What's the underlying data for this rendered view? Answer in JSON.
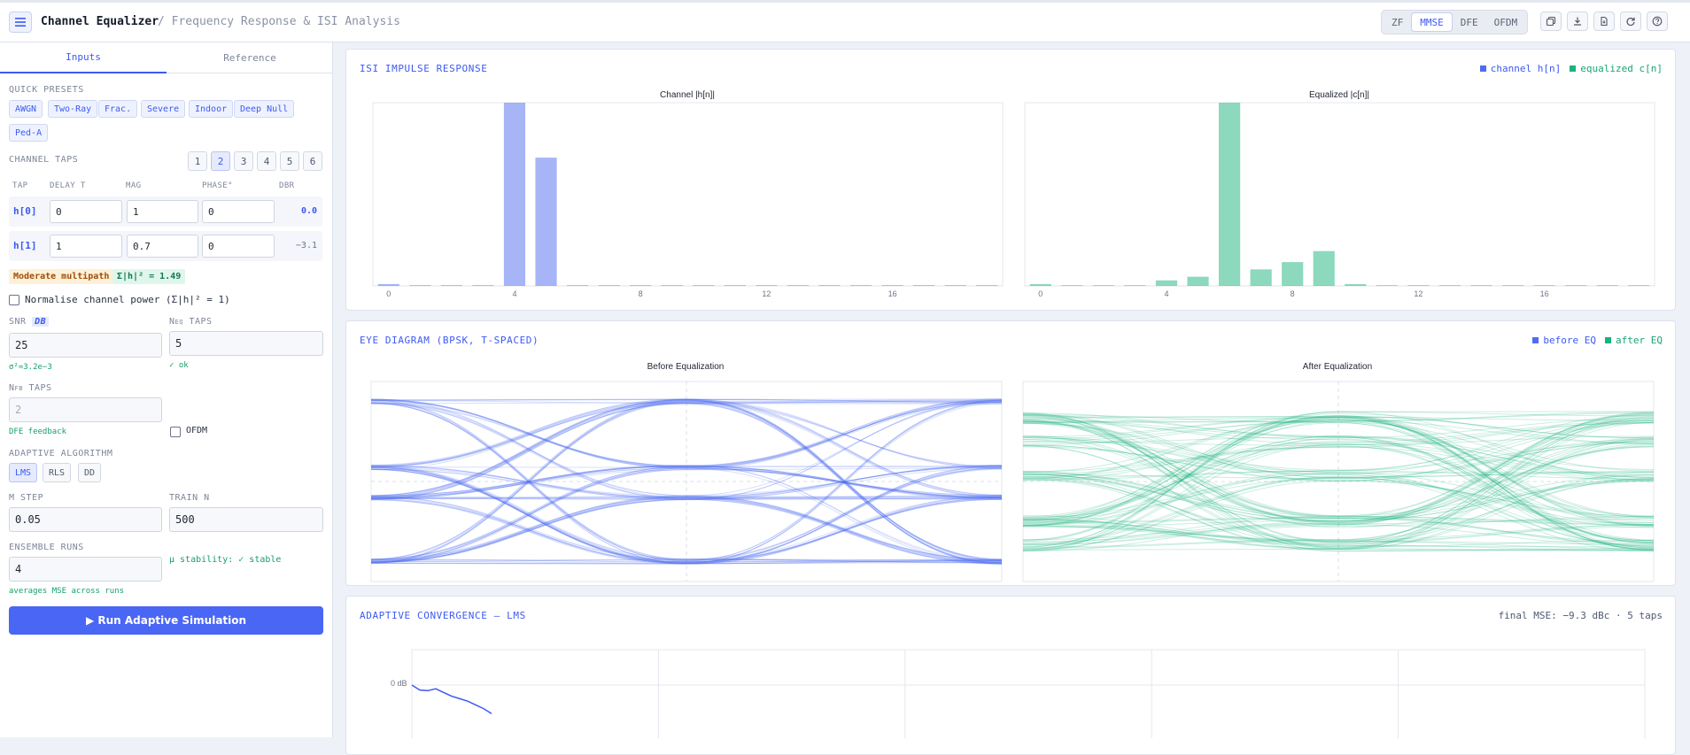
{
  "header": {
    "title": "Channel Equalizer",
    "subtitle": "/ Frequency Response & ISI Analysis",
    "modes": [
      "ZF",
      "MMSE",
      "DFE",
      "OFDM"
    ],
    "active_mode": "MMSE",
    "icons": [
      "copy-icon",
      "download-icon",
      "export-file-icon",
      "refresh-icon",
      "help-icon"
    ]
  },
  "sidebar": {
    "tabs": [
      "Inputs",
      "Reference"
    ],
    "presets_label": "QUICK PRESETS",
    "presets": [
      "AWGN",
      "Two-Ray",
      "Frac.",
      "Severe",
      "Indoor",
      "Deep Null",
      "Ped-A"
    ],
    "channel_taps_label": "CHANNEL TAPS",
    "tap_counts": [
      "1",
      "2",
      "3",
      "4",
      "5",
      "6"
    ],
    "active_tap_count": "2",
    "columns": [
      "TAP",
      "DELAY T",
      "MAG",
      "PHASE°",
      "DBR"
    ],
    "taps": [
      {
        "name": "h[0]",
        "delay": "0",
        "mag": "1",
        "phase": "0",
        "dbr": "0.0"
      },
      {
        "name": "h[1]",
        "delay": "1",
        "mag": "0.7",
        "phase": "0",
        "dbr": "−3.1"
      }
    ],
    "multipath_badge": "Moderate multipath",
    "power_badge": "Σ|h|² = 1.49",
    "normalise_label": "Normalise channel power (Σ|h|² = 1)",
    "snr_label": "SNR",
    "snr_unit": "DB",
    "snr_value": "25",
    "snr_note": "σ²=3.2e−3",
    "neq_label_pre": "N",
    "neq_label_sub": "EQ",
    "neq_label_post": "TAPS",
    "neq_value": "5",
    "neq_note": "✓ ok",
    "nfb_label_pre": "N",
    "nfb_label_sub": "FB",
    "nfb_label_post": "TAPS",
    "nfb_value": "2",
    "nfb_note": "DFE feedback",
    "ofdm_label": "OFDM",
    "algo_label": "ADAPTIVE ALGORITHM",
    "algos": [
      "LMS",
      "RLS",
      "DD"
    ],
    "active_algo": "LMS",
    "mu_label": "Μ STEP",
    "mu_value": "0.05",
    "train_label": "TRAIN N",
    "train_value": "500",
    "ensemble_label": "ENSEMBLE RUNS",
    "ensemble_value": "4",
    "ensemble_note": "averages MSE across runs",
    "stability": "μ stability: ✓ stable",
    "run_button": "▶ Run Adaptive Simulation"
  },
  "isi_panel": {
    "title": "ISI IMPULSE RESPONSE",
    "legend": [
      "channel h[n]",
      "equalized c[n]"
    ],
    "colors": {
      "channel": "#4f6cf0",
      "equalized": "#19b37c"
    }
  },
  "eye_panel": {
    "title": "EYE DIAGRAM (BPSK, T-SPACED)",
    "legend": [
      "before EQ",
      "after EQ"
    ],
    "before_title": "Before Equalization",
    "after_title": "After Equalization"
  },
  "conv_panel": {
    "title": "ADAPTIVE CONVERGENCE — LMS",
    "summary": "final MSE: −9.3 dBc · 5 taps",
    "y_tick": "0 dB"
  },
  "chart_data": [
    {
      "type": "bar",
      "title": "Channel |h[n]|",
      "x": [
        0,
        1,
        2,
        3,
        4,
        5,
        6,
        7,
        8,
        9,
        10,
        11,
        12,
        13,
        14,
        15,
        16,
        17,
        18,
        19
      ],
      "values": [
        0.01,
        0,
        0,
        0,
        1.0,
        0.7,
        0,
        0,
        0,
        0,
        0,
        0,
        0,
        0,
        0,
        0,
        0,
        0,
        0,
        0
      ],
      "x_ticks": [
        "0",
        "4",
        "8",
        "12",
        "16"
      ],
      "ylim": [
        0,
        1.0
      ]
    },
    {
      "type": "bar",
      "title": "Equalized |c[n]|",
      "x": [
        0,
        1,
        2,
        3,
        4,
        5,
        6,
        7,
        8,
        9,
        10,
        11,
        12,
        13,
        14,
        15,
        16,
        17,
        18,
        19
      ],
      "values": [
        0.01,
        0,
        0,
        0,
        0.03,
        0.05,
        1.0,
        0.09,
        0.13,
        0.19,
        0.01,
        0,
        0,
        0,
        0,
        0,
        0,
        0,
        0,
        0
      ],
      "x_ticks": [
        "0",
        "4",
        "8",
        "12",
        "16"
      ],
      "ylim": [
        0,
        1.0
      ]
    },
    {
      "type": "line",
      "title": "",
      "series": [
        {
          "values": [
            0,
            -0.4,
            -0.45,
            -0.3,
            -0.6,
            -0.9,
            -1.1,
            -1.3,
            -1.6,
            -1.9,
            -2.3
          ]
        }
      ],
      "y_ticks": [
        "0 dB"
      ]
    }
  ]
}
